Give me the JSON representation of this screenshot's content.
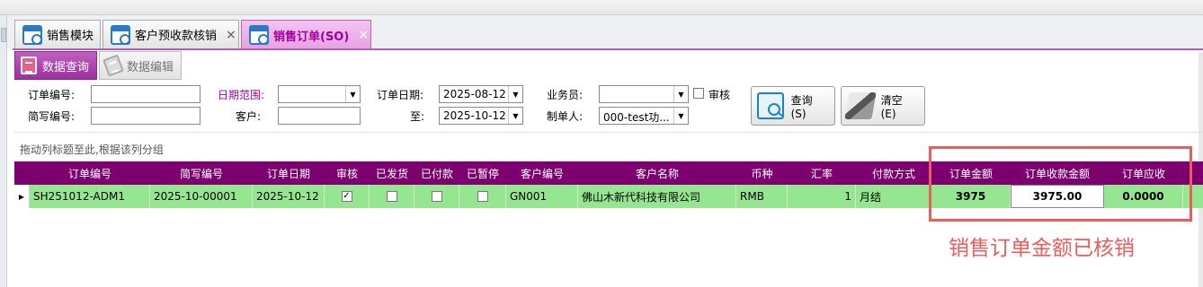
{
  "tabs": [
    {
      "label": "销售模块"
    },
    {
      "label": "客户预收款核销",
      "close": "×"
    },
    {
      "label": "销售订单(SO)",
      "close": "×"
    }
  ],
  "subtabs": [
    {
      "label": "数据查询"
    },
    {
      "label": "数据编辑"
    }
  ],
  "filter": {
    "order_no_label": "订单编号:",
    "order_no_value": "",
    "short_no_label": "简写编号:",
    "short_no_value": "",
    "date_range_label": "日期范围:",
    "date_range_value": "",
    "customer_label": "客户:",
    "customer_value": "",
    "order_date_label": "订单日期:",
    "order_date_from": "2025-08-12",
    "to_label": "至:",
    "order_date_to": "2025-10-12",
    "salesman_label": "业务员:",
    "salesman_value": "",
    "creator_label": "制单人:",
    "creator_value": "000-test功...",
    "audit_label": "审核",
    "query_button": "查询(S)",
    "clear_button": "清空(E)"
  },
  "group_hint": "拖动列标题至此,根据该列分组",
  "grid": {
    "columns": [
      "订单编号",
      "简写编号",
      "订单日期",
      "审核",
      "已发货",
      "已付款",
      "已暂停",
      "客户编号",
      "客户名称",
      "币种",
      "汇率",
      "付款方式",
      "订单金额",
      "订单收款金额",
      "订单应收"
    ],
    "rows": [
      {
        "order_no": "SH251012-ADM1",
        "short_no": "2025-10-00001",
        "order_date": "2025-10-12",
        "audited": true,
        "shipped": false,
        "paid": false,
        "paused": false,
        "customer_no": "GN001",
        "customer_name": "佛山木新代科技有限公司",
        "currency": "RMB",
        "rate": "1",
        "pay_method": "月结",
        "amount": "3975",
        "received": "3975.00",
        "receivable": "0.0000"
      }
    ]
  },
  "annotation": "销售订单金额已核销",
  "colors": {
    "header": "#7d006f",
    "row": "#96e691",
    "accent": "#a000a0",
    "annotation": "#ee5b5b"
  }
}
